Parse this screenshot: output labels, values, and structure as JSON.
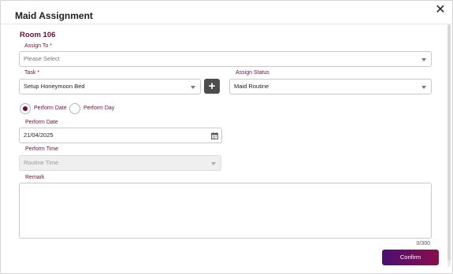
{
  "dialog": {
    "title": "Maid Assignment",
    "close_symbol": "✕"
  },
  "room": {
    "label": "Room 106"
  },
  "assign_to": {
    "label": "Assign To *",
    "placeholder": "Please Select"
  },
  "task": {
    "label": "Task *",
    "value": "Setup Honeymoon Bed",
    "add_symbol": "+"
  },
  "assign_status": {
    "label": "Assign Status",
    "value": "Maid Routine"
  },
  "perform_mode": {
    "options": [
      "Perform Date",
      "Perform Day"
    ],
    "selected": "Perform Date"
  },
  "perform_date": {
    "label": "Perform Date",
    "value": "21/04/2025"
  },
  "perform_time": {
    "label": "Perform Time",
    "placeholder": "Routine Time"
  },
  "remark": {
    "label": "Remark",
    "value": "",
    "counter": "0/300"
  },
  "actions": {
    "confirm_label": "Confirm"
  },
  "colors": {
    "accent": "#6d0f3a",
    "button_gradient_start": "#4a1073",
    "button_gradient_end": "#8a0d4c"
  },
  "icons": {
    "close": "close-icon",
    "calendar": "calendar-icon",
    "dropdown": "chevron-down-icon",
    "add": "plus-icon"
  }
}
